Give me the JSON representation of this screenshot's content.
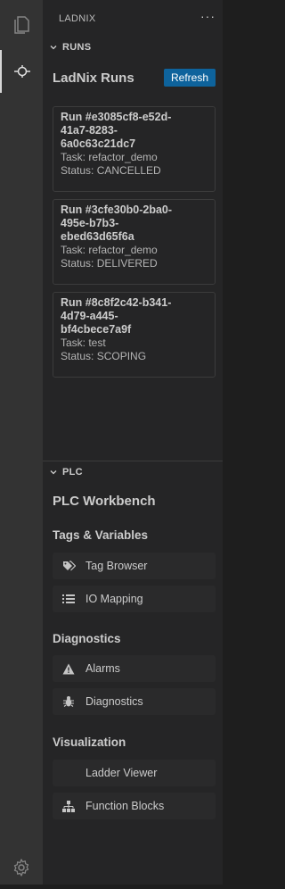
{
  "sidebar": {
    "title": "LADNIX",
    "more": "···"
  },
  "runs": {
    "section_label": "RUNS",
    "heading": "LadNix Runs",
    "refresh_label": "Refresh",
    "items": [
      {
        "id_lines": [
          "Run #e3085cf8-e52d-",
          "41a7-8283-",
          "6a0c63c21dc7"
        ],
        "task": "Task: refactor_demo",
        "status": "Status: CANCELLED"
      },
      {
        "id_lines": [
          "Run #3cfe30b0-2ba0-",
          "495e-b7b3-",
          "ebed63d65f6a"
        ],
        "task": "Task: refactor_demo",
        "status": "Status: DELIVERED"
      },
      {
        "id_lines": [
          "Run #8c8f2c42-b341-",
          "4d79-a445-",
          "bf4cbece7a9f"
        ],
        "task": "Task: test",
        "status": "Status: SCOPING"
      }
    ]
  },
  "plc": {
    "section_label": "PLC",
    "heading": "PLC Workbench",
    "groups": [
      {
        "title": "Tags & Variables",
        "items": [
          {
            "label": "Tag Browser",
            "icon": "tags-icon"
          },
          {
            "label": "IO Mapping",
            "icon": "list-icon"
          }
        ]
      },
      {
        "title": "Diagnostics",
        "items": [
          {
            "label": "Alarms",
            "icon": "warning-icon"
          },
          {
            "label": "Diagnostics",
            "icon": "bug-icon"
          }
        ]
      },
      {
        "title": "Visualization",
        "items": [
          {
            "label": "Ladder Viewer",
            "icon": ""
          },
          {
            "label": "Function Blocks",
            "icon": "hierarchy-icon"
          }
        ]
      }
    ]
  }
}
